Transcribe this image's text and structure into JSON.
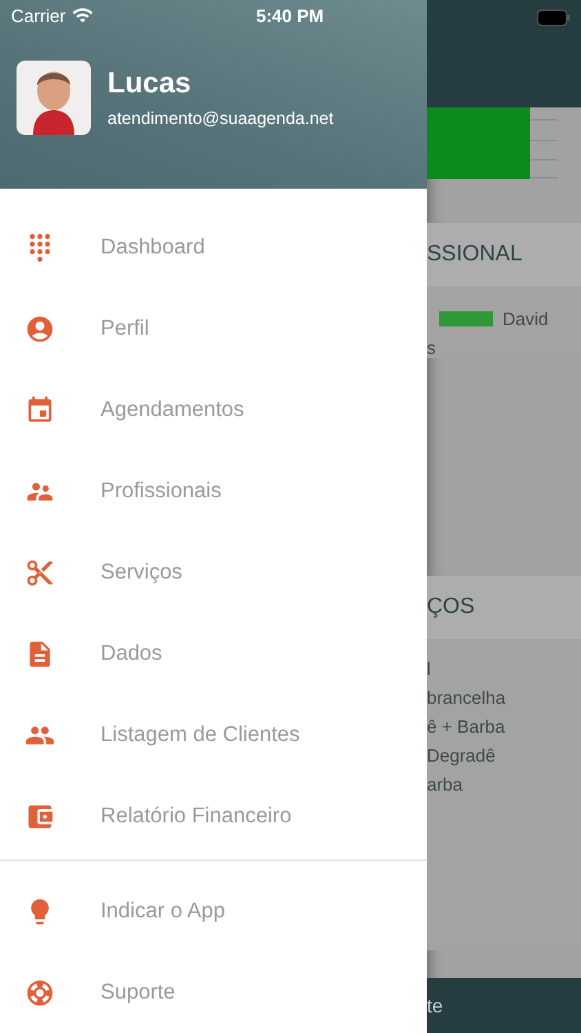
{
  "status_bar": {
    "carrier": "Carrier",
    "time": "5:40 PM"
  },
  "drawer": {
    "user": {
      "name": "Lucas",
      "email": "atendimento@suaagenda.net"
    },
    "menu": [
      {
        "label": "Dashboard"
      },
      {
        "label": "Perfil"
      },
      {
        "label": "Agendamentos"
      },
      {
        "label": "Profissionais"
      },
      {
        "label": "Serviços"
      },
      {
        "label": "Dados"
      },
      {
        "label": "Listagem de Clientes"
      },
      {
        "label": "Relatório Financeiro"
      }
    ],
    "secondary_menu": [
      {
        "label": "Indicar o App"
      },
      {
        "label": "Suporte"
      }
    ]
  },
  "background_screen": {
    "section_1": {
      "title": "SSIONAL",
      "legend": [
        {
          "label": "David",
          "color": "#2f9a35"
        }
      ],
      "line_2": "s"
    },
    "section_2": {
      "title": "ÇOS",
      "items": [
        "l",
        "brancelha",
        "ê + Barba",
        "Degradê",
        "arba"
      ]
    },
    "bottom_bar": {
      "label": "te"
    }
  }
}
